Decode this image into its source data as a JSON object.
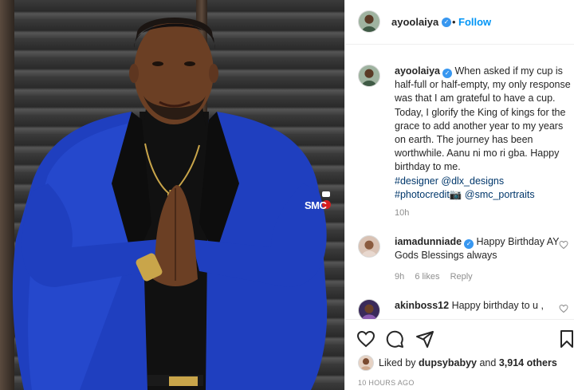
{
  "post": {
    "username": "ayoolaiya",
    "follow_label": "Follow",
    "separator": "•",
    "caption_text": "When asked if my cup is half-full or half-empty, my only response was that I am grateful to have a cup. Today, I glorify the King of kings for the grace to add another year to my years on earth. The journey has been worthwhile. Aanu ni mo ri gba. Happy birthday to me.",
    "caption_tags": [
      "#designer",
      "@dlx_designs",
      "#photocredit",
      "@smc_portraits"
    ],
    "caption_time": "10h",
    "watermark": "SMC"
  },
  "comments": [
    {
      "username": "iamadunniade",
      "text": "Happy Birthday AY Gods Blessings always",
      "time": "9h",
      "likes": "6 likes",
      "reply": "Reply"
    },
    {
      "username": "akinboss12",
      "text": "Happy birthday to u ,",
      "time": "",
      "likes": "",
      "reply": ""
    }
  ],
  "likes": {
    "prefix": "Liked by",
    "user": "dupsybabyy",
    "middle": "and",
    "count": "3,914 others"
  },
  "timestamp": "10 HOURS AGO",
  "icons": [
    "heart-icon",
    "comment-icon",
    "share-icon",
    "bookmark-icon",
    "verified-icon"
  ],
  "colors": {
    "accent": "#0095f6",
    "verified": "#3897f0",
    "jacket": "#1f3fbf"
  }
}
